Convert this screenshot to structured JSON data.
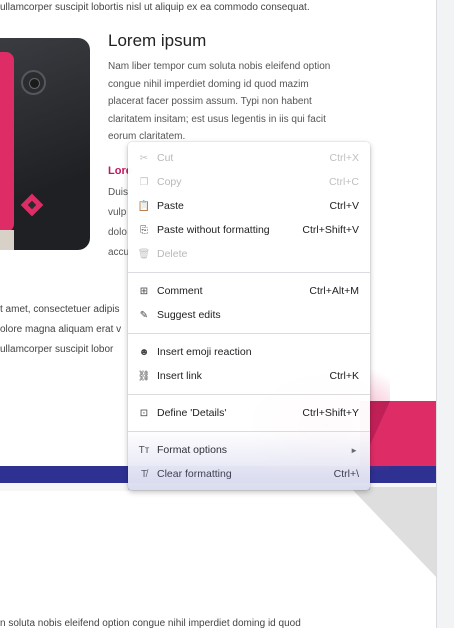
{
  "document": {
    "top_line": "ullamcorper suscipit lobortis nisl ut aliquip ex ea commodo consequat.",
    "heading": "Lorem ipsum",
    "paragraph_lines": [
      "Nam liber tempor cum soluta nobis eleifend option",
      "congue nihil imperdiet doming id quod mazim",
      "placerat facer possim assum. Typi non habent",
      "claritatem insitam; est usus legentis in iis qui facit",
      "eorum claritatem."
    ],
    "pink_heading_partial": "Lore",
    "partial_lines": [
      "Duis",
      "vulp",
      "dolo",
      "accu"
    ],
    "lower_lines": [
      "t amet, consectetuer adipis",
      "olore magna aliquam erat v",
      "ullamcorper suscipit lobor"
    ],
    "bottom_line": "n soluta nobis eleifend option congue nihil imperdiet doming id quod"
  },
  "context_menu": {
    "groups": [
      [
        {
          "icon": "cut-icon",
          "glyph": "✂",
          "label": "Cut",
          "shortcut": "Ctrl+X",
          "disabled": true
        },
        {
          "icon": "copy-icon",
          "glyph": "❐",
          "label": "Copy",
          "shortcut": "Ctrl+C",
          "disabled": true
        },
        {
          "icon": "paste-icon",
          "glyph": "📋",
          "label": "Paste",
          "shortcut": "Ctrl+V",
          "disabled": false
        },
        {
          "icon": "paste-plain-icon",
          "glyph": "⎘",
          "label": "Paste without formatting",
          "shortcut": "Ctrl+Shift+V",
          "disabled": false
        },
        {
          "icon": "delete-icon",
          "glyph": "🗑",
          "label": "Delete",
          "shortcut": "",
          "disabled": true
        }
      ],
      [
        {
          "icon": "comment-icon",
          "glyph": "⊞",
          "label": "Comment",
          "shortcut": "Ctrl+Alt+M",
          "disabled": false
        },
        {
          "icon": "suggest-edits-icon",
          "glyph": "✎",
          "label": "Suggest edits",
          "shortcut": "",
          "disabled": false
        }
      ],
      [
        {
          "icon": "emoji-icon",
          "glyph": "☻",
          "label": "Insert emoji reaction",
          "shortcut": "",
          "disabled": false
        },
        {
          "icon": "link-icon",
          "glyph": "⛓",
          "label": "Insert link",
          "shortcut": "Ctrl+K",
          "disabled": false
        }
      ],
      [
        {
          "icon": "define-icon",
          "glyph": "⊡",
          "label": "Define 'Details'",
          "shortcut": "Ctrl+Shift+Y",
          "disabled": false
        }
      ],
      [
        {
          "icon": "format-options-icon",
          "glyph": "Tт",
          "label": "Format options",
          "shortcut": "",
          "submenu": true,
          "disabled": false
        },
        {
          "icon": "clear-formatting-icon",
          "glyph": "T̸",
          "label": "Clear formatting",
          "shortcut": "Ctrl+\\",
          "disabled": false
        }
      ]
    ]
  },
  "colors": {
    "accent_pink": "#dd2c66",
    "navy": "#2e3192"
  }
}
